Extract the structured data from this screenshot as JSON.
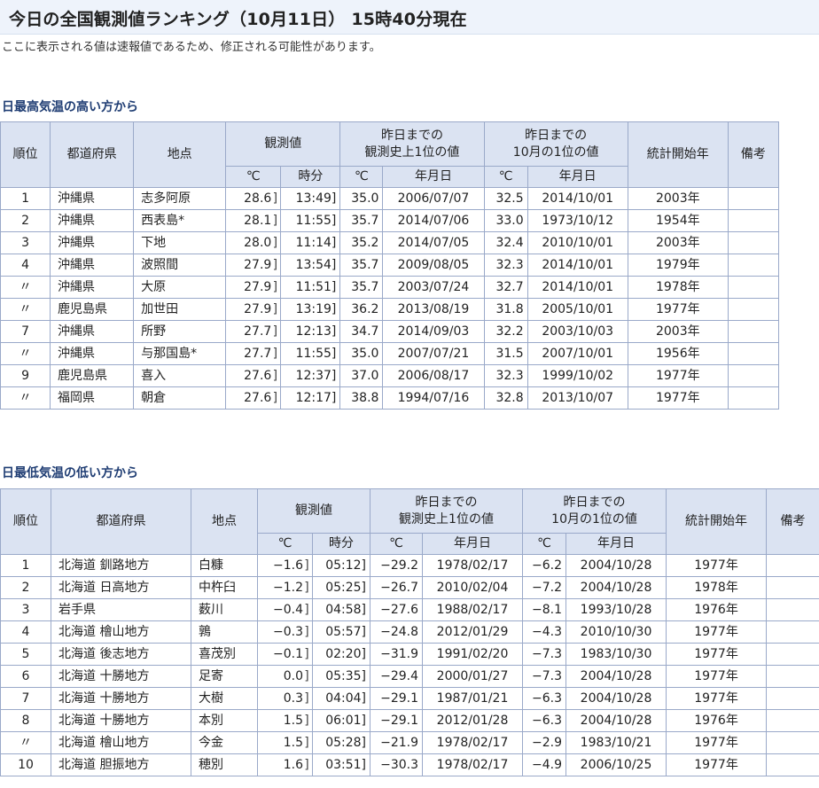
{
  "page": {
    "title": "今日の全国観測値ランキング（10月11日） 15時40分現在",
    "note": "ここに表示される値は速報値であるため、修正される可能性があります。"
  },
  "sections": [
    {
      "title": "日最高気温の高い方から",
      "headers": {
        "rank": "順位",
        "pref": "都道府県",
        "place": "地点",
        "obs": "観測値",
        "hist_line1": "昨日までの",
        "hist_line2": "観測史上1位の値",
        "month_line1": "昨日までの",
        "month_line2": "10月の1位の値",
        "start": "統計開始年",
        "remarks": "備考",
        "unit_c": "℃",
        "unit_time": "時分",
        "unit_date": "年月日"
      },
      "rows": [
        {
          "rank": "1",
          "pref": "沖縄県",
          "place": "志多阿原",
          "value": "28.6",
          "flag": "]",
          "time": "13:49]",
          "hist_val": "35.0",
          "hist_date": "2006/07/07",
          "mon_val": "32.5",
          "mon_date": "2014/10/01",
          "start": "2003年",
          "remarks": ""
        },
        {
          "rank": "2",
          "pref": "沖縄県",
          "place": "西表島*",
          "value": "28.1",
          "flag": "]",
          "time": "11:55]",
          "hist_val": "35.7",
          "hist_date": "2014/07/06",
          "mon_val": "33.0",
          "mon_date": "1973/10/12",
          "start": "1954年",
          "remarks": ""
        },
        {
          "rank": "3",
          "pref": "沖縄県",
          "place": "下地",
          "value": "28.0",
          "flag": "]",
          "time": "11:14]",
          "hist_val": "35.2",
          "hist_date": "2014/07/05",
          "mon_val": "32.4",
          "mon_date": "2010/10/01",
          "start": "2003年",
          "remarks": ""
        },
        {
          "rank": "4",
          "pref": "沖縄県",
          "place": "波照間",
          "value": "27.9",
          "flag": "]",
          "time": "13:54]",
          "hist_val": "35.7",
          "hist_date": "2009/08/05",
          "mon_val": "32.3",
          "mon_date": "2014/10/01",
          "start": "1979年",
          "remarks": ""
        },
        {
          "rank": "〃",
          "pref": "沖縄県",
          "place": "大原",
          "value": "27.9",
          "flag": "]",
          "time": "11:51]",
          "hist_val": "35.7",
          "hist_date": "2003/07/24",
          "mon_val": "32.7",
          "mon_date": "2014/10/01",
          "start": "1978年",
          "remarks": ""
        },
        {
          "rank": "〃",
          "pref": "鹿児島県",
          "place": "加世田",
          "value": "27.9",
          "flag": "]",
          "time": "13:19]",
          "hist_val": "36.2",
          "hist_date": "2013/08/19",
          "mon_val": "31.8",
          "mon_date": "2005/10/01",
          "start": "1977年",
          "remarks": ""
        },
        {
          "rank": "7",
          "pref": "沖縄県",
          "place": "所野",
          "value": "27.7",
          "flag": "]",
          "time": "12:13]",
          "hist_val": "34.7",
          "hist_date": "2014/09/03",
          "mon_val": "32.2",
          "mon_date": "2003/10/03",
          "start": "2003年",
          "remarks": ""
        },
        {
          "rank": "〃",
          "pref": "沖縄県",
          "place": "与那国島*",
          "value": "27.7",
          "flag": "]",
          "time": "11:55]",
          "hist_val": "35.0",
          "hist_date": "2007/07/21",
          "mon_val": "31.5",
          "mon_date": "2007/10/01",
          "start": "1956年",
          "remarks": ""
        },
        {
          "rank": "9",
          "pref": "鹿児島県",
          "place": "喜入",
          "value": "27.6",
          "flag": "]",
          "time": "12:37]",
          "hist_val": "37.0",
          "hist_date": "2006/08/17",
          "mon_val": "32.3",
          "mon_date": "1999/10/02",
          "start": "1977年",
          "remarks": ""
        },
        {
          "rank": "〃",
          "pref": "福岡県",
          "place": "朝倉",
          "value": "27.6",
          "flag": "]",
          "time": "12:17]",
          "hist_val": "38.8",
          "hist_date": "1994/07/16",
          "mon_val": "32.8",
          "mon_date": "2013/10/07",
          "start": "1977年",
          "remarks": ""
        }
      ]
    },
    {
      "title": "日最低気温の低い方から",
      "headers": {
        "rank": "順位",
        "pref": "都道府県",
        "place": "地点",
        "obs": "観測値",
        "hist_line1": "昨日までの",
        "hist_line2": "観測史上1位の値",
        "month_line1": "昨日までの",
        "month_line2": "10月の1位の値",
        "start": "統計開始年",
        "remarks": "備考",
        "unit_c": "℃",
        "unit_time": "時分",
        "unit_date": "年月日"
      },
      "rows": [
        {
          "rank": "1",
          "pref": "北海道 釧路地方",
          "place": "白糠",
          "value": "−1.6",
          "flag": "]",
          "time": "05:12]",
          "hist_val": "−29.2",
          "hist_date": "1978/02/17",
          "mon_val": "−6.2",
          "mon_date": "2004/10/28",
          "start": "1977年",
          "remarks": ""
        },
        {
          "rank": "2",
          "pref": "北海道 日高地方",
          "place": "中杵臼",
          "value": "−1.2",
          "flag": "]",
          "time": "05:25]",
          "hist_val": "−26.7",
          "hist_date": "2010/02/04",
          "mon_val": "−7.2",
          "mon_date": "2004/10/28",
          "start": "1978年",
          "remarks": ""
        },
        {
          "rank": "3",
          "pref": "岩手県",
          "place": "薮川",
          "value": "−0.4",
          "flag": "]",
          "time": "04:58]",
          "hist_val": "−27.6",
          "hist_date": "1988/02/17",
          "mon_val": "−8.1",
          "mon_date": "1993/10/28",
          "start": "1976年",
          "remarks": ""
        },
        {
          "rank": "4",
          "pref": "北海道 檜山地方",
          "place": "鶉",
          "value": "−0.3",
          "flag": "]",
          "time": "05:57]",
          "hist_val": "−24.8",
          "hist_date": "2012/01/29",
          "mon_val": "−4.3",
          "mon_date": "2010/10/30",
          "start": "1977年",
          "remarks": ""
        },
        {
          "rank": "5",
          "pref": "北海道 後志地方",
          "place": "喜茂別",
          "value": "−0.1",
          "flag": "]",
          "time": "02:20]",
          "hist_val": "−31.9",
          "hist_date": "1991/02/20",
          "mon_val": "−7.3",
          "mon_date": "1983/10/30",
          "start": "1977年",
          "remarks": ""
        },
        {
          "rank": "6",
          "pref": "北海道 十勝地方",
          "place": "足寄",
          "value": "0.0",
          "flag": "]",
          "time": "05:35]",
          "hist_val": "−29.4",
          "hist_date": "2000/01/27",
          "mon_val": "−7.3",
          "mon_date": "2004/10/28",
          "start": "1977年",
          "remarks": ""
        },
        {
          "rank": "7",
          "pref": "北海道 十勝地方",
          "place": "大樹",
          "value": "0.3",
          "flag": "]",
          "time": "04:04]",
          "hist_val": "−29.1",
          "hist_date": "1987/01/21",
          "mon_val": "−6.3",
          "mon_date": "2004/10/28",
          "start": "1977年",
          "remarks": ""
        },
        {
          "rank": "8",
          "pref": "北海道 十勝地方",
          "place": "本別",
          "value": "1.5",
          "flag": "]",
          "time": "06:01]",
          "hist_val": "−29.1",
          "hist_date": "2012/01/28",
          "mon_val": "−6.3",
          "mon_date": "2004/10/28",
          "start": "1976年",
          "remarks": ""
        },
        {
          "rank": "〃",
          "pref": "北海道 檜山地方",
          "place": "今金",
          "value": "1.5",
          "flag": "]",
          "time": "05:28]",
          "hist_val": "−21.9",
          "hist_date": "1978/02/17",
          "mon_val": "−2.9",
          "mon_date": "1983/10/21",
          "start": "1977年",
          "remarks": ""
        },
        {
          "rank": "10",
          "pref": "北海道 胆振地方",
          "place": "穂別",
          "value": "1.6",
          "flag": "]",
          "time": "03:51]",
          "hist_val": "−30.3",
          "hist_date": "1978/02/17",
          "mon_val": "−4.9",
          "mon_date": "2006/10/25",
          "start": "1977年",
          "remarks": ""
        }
      ]
    }
  ]
}
